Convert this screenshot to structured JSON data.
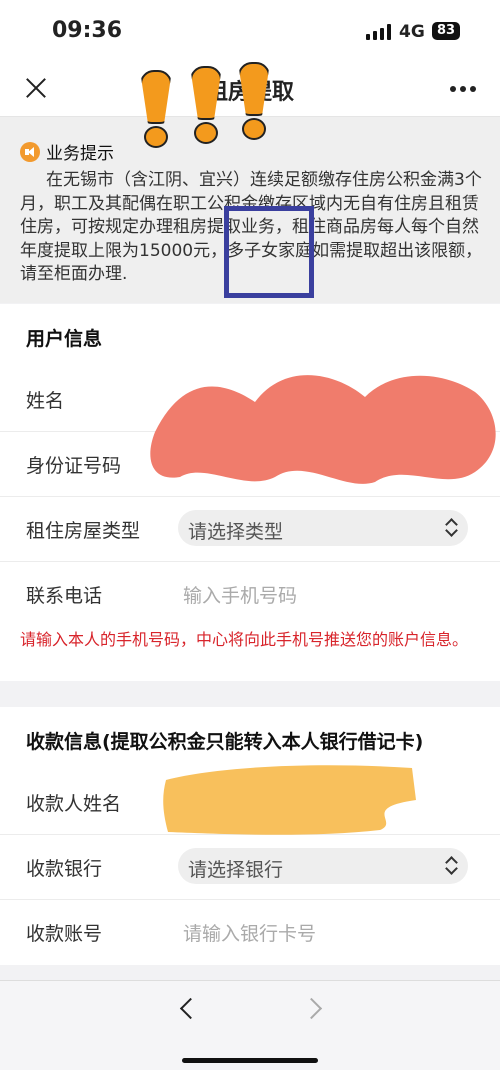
{
  "status_bar": {
    "time": "09:36",
    "network": "4G",
    "battery": "83"
  },
  "nav": {
    "title": "租房提取"
  },
  "notice": {
    "title": "业务提示",
    "body": "在无锡市（含江阴、宜兴）连续足额缴存住房公积金满3个月，职工及其配偶在职工公积金缴存区域内无自有住房且租赁住房，可按规定办理租房提取业务，租住商品房每人每个自然年度提取上限为15000元，多子女家庭如需提取超出该限额，请至柜面办理."
  },
  "user_info": {
    "title": "用户信息",
    "name_label": "姓名",
    "id_label": "身份证号码",
    "house_type_label": "租住房屋类型",
    "house_type_value": "请选择类型",
    "phone_label": "联系电话",
    "phone_placeholder": "输入手机号码",
    "warning": "请输入本人的手机号码，中心将向此手机号推送您的账户信息。"
  },
  "payment_info": {
    "title": "收款信息(提取公积金只能转入本人银行借记卡)",
    "payee_label": "收款人姓名",
    "bank_label": "收款银行",
    "bank_value": "请选择银行",
    "account_label": "收款账号",
    "account_placeholder": "请输入银行卡号"
  },
  "colors": {
    "accent_orange": "#f39a1d",
    "warning_red": "#d8242b",
    "highlight_box": "#3a3f9e",
    "redact_red": "#f07c6c",
    "redact_yellow": "#f8c05c"
  },
  "icons": [
    "close-icon",
    "more-icon",
    "speaker-icon",
    "chevron-icon",
    "back-icon",
    "forward-icon"
  ]
}
